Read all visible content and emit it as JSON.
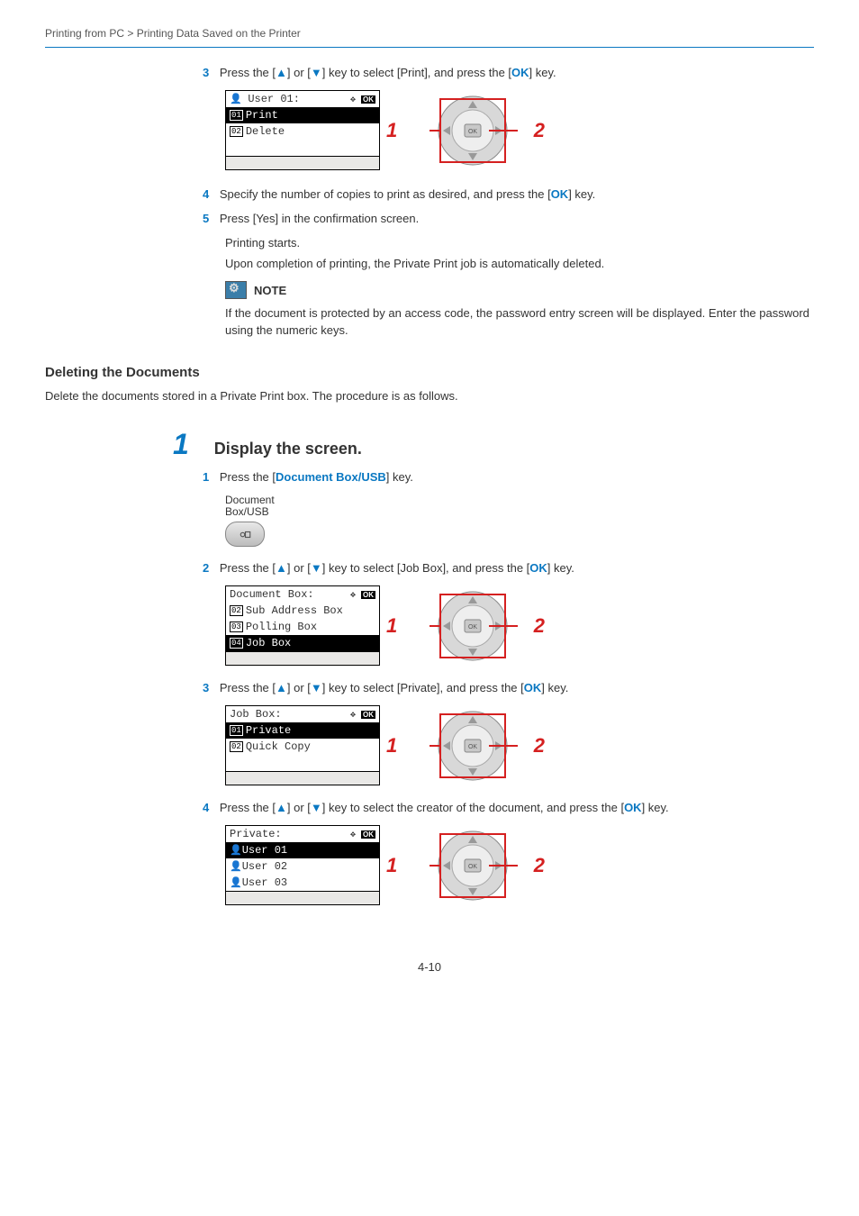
{
  "breadcrumb": "Printing from PC > Printing Data Saved on the Printer",
  "topSteps": {
    "s3": {
      "num": "3",
      "pre": "Press the [",
      "mid1": "] or [",
      "mid2": "] key to select [Print], and press the [",
      "ok": "OK",
      "post": "] key.",
      "lcd": {
        "title": "User 01:",
        "items": [
          {
            "n": "01",
            "t": "Print",
            "sel": true
          },
          {
            "n": "02",
            "t": "Delete",
            "sel": false
          }
        ]
      }
    },
    "s4": {
      "num": "4",
      "pre": "Specify the number of copies to print as desired, and press the [",
      "ok": "OK",
      "post": "] key."
    },
    "s5": {
      "num": "5",
      "text": "Press [Yes] in the confirmation screen."
    },
    "s5a": "Printing starts.",
    "s5b": "Upon completion of printing, the Private Print job is automatically deleted.",
    "note": {
      "title": "NOTE",
      "body": "If the document is protected by an access code, the password entry screen will be displayed. Enter the password using the numeric keys."
    }
  },
  "section": {
    "heading": "Deleting the Documents",
    "lead": "Delete the documents stored in a Private Print box. The procedure is as follows."
  },
  "big": {
    "num": "1",
    "title": "Display the screen."
  },
  "sub": {
    "s1": {
      "num": "1",
      "pre": "Press the [",
      "key": "Document Box/USB",
      "post": "] key.",
      "keyLabel": "Document\nBox/USB"
    },
    "s2": {
      "num": "2",
      "pre": "Press the [",
      "mid1": "] or [",
      "mid2": "] key to select [Job Box], and press the [",
      "ok": "OK",
      "post": "] key.",
      "lcd": {
        "title": "Document Box:",
        "items": [
          {
            "n": "02",
            "t": "Sub Address Box",
            "sel": false
          },
          {
            "n": "03",
            "t": "Polling Box",
            "sel": false
          },
          {
            "n": "04",
            "t": "Job Box",
            "sel": true
          }
        ]
      }
    },
    "s3": {
      "num": "3",
      "pre": "Press the [",
      "mid1": "] or [",
      "mid2": "] key to select [Private], and press the [",
      "ok": "OK",
      "post": "] key.",
      "lcd": {
        "title": "Job Box:",
        "items": [
          {
            "n": "01",
            "t": "Private",
            "sel": true
          },
          {
            "n": "02",
            "t": "Quick Copy",
            "sel": false
          }
        ]
      }
    },
    "s4": {
      "num": "4",
      "pre": "Press the [",
      "mid1": "] or [",
      "mid2": "] key to select the creator of the document, and press the [",
      "ok": "OK",
      "post": "] key.",
      "lcd": {
        "title": "Private:",
        "users": [
          "User 01",
          "User 02",
          "User 03"
        ],
        "selIndex": 0
      }
    }
  },
  "callouts": {
    "one": "1",
    "two": "2"
  },
  "page": "4-10"
}
